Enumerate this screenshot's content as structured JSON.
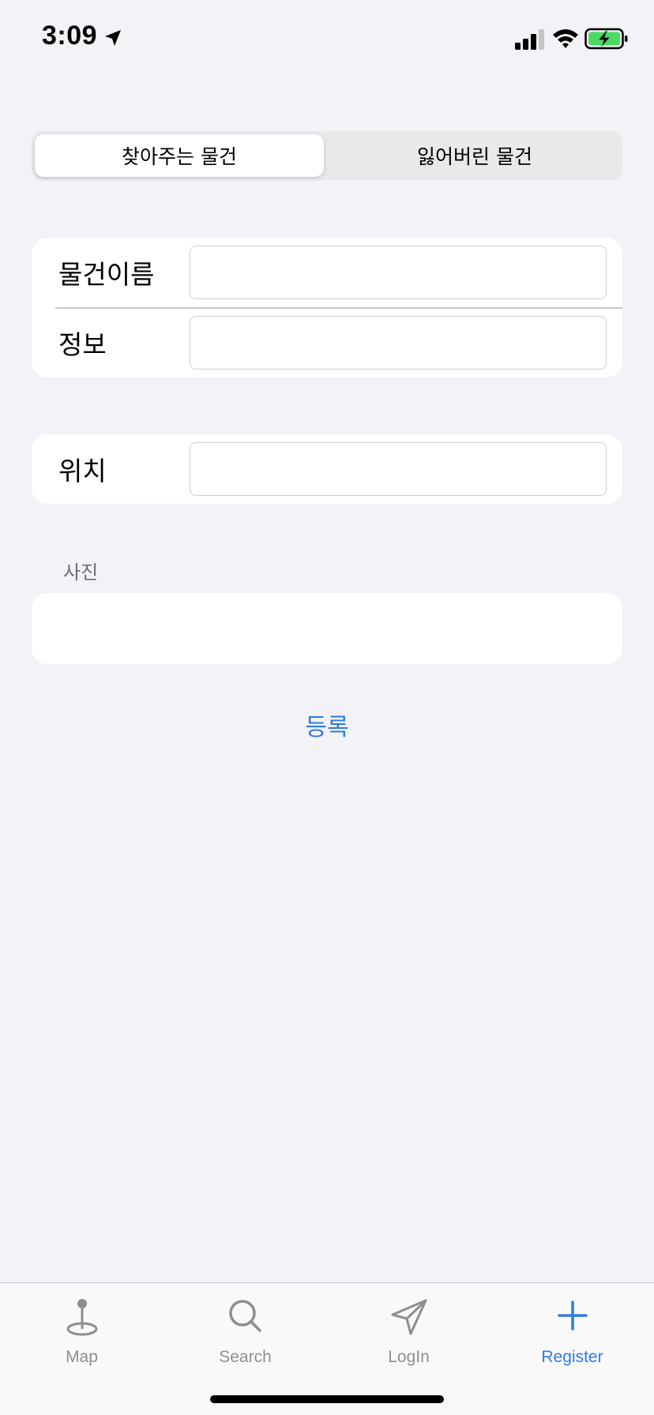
{
  "status_bar": {
    "time": "3:09"
  },
  "segmented_control": {
    "segments": [
      {
        "label": "찾아주는 물건",
        "selected": true
      },
      {
        "label": "잃어버린 물건",
        "selected": false
      }
    ]
  },
  "form": {
    "item_name_label": "물건이름",
    "item_name_value": "",
    "info_label": "정보",
    "info_value": "",
    "location_label": "위치",
    "location_value": "",
    "photo_section_header": "사진",
    "submit_label": "등록"
  },
  "tab_bar": {
    "items": [
      {
        "label": "Map",
        "icon": "map-pin-icon",
        "active": false
      },
      {
        "label": "Search",
        "icon": "magnifier-icon",
        "active": false
      },
      {
        "label": "LogIn",
        "icon": "paper-plane-icon",
        "active": false
      },
      {
        "label": "Register",
        "icon": "plus-icon",
        "active": true
      }
    ]
  },
  "colors": {
    "background": "#f2f2f7",
    "accent": "#2f7bdf",
    "tab_inactive": "#8e8e93",
    "battery_green": "#4cd964"
  }
}
